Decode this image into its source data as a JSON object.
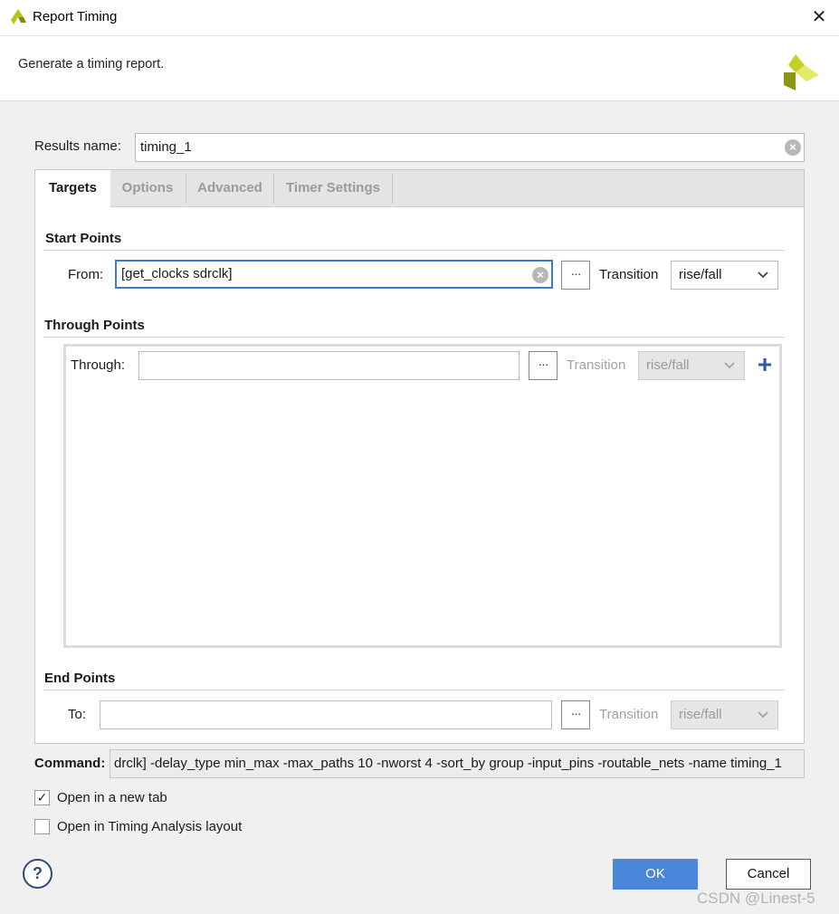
{
  "window": {
    "title": "Report Timing",
    "close_glyph": "✕"
  },
  "header": {
    "subtitle": "Generate a timing report."
  },
  "results_name": {
    "label": "Results name:",
    "value": "timing_1"
  },
  "tabs": [
    {
      "label": "Targets",
      "active": true
    },
    {
      "label": "Options",
      "active": false
    },
    {
      "label": "Advanced",
      "active": false
    },
    {
      "label": "Timer Settings",
      "active": false
    }
  ],
  "start_points": {
    "title": "Start Points",
    "from_label": "From:",
    "from_value": "[get_clocks sdrclk]",
    "browse_label": "···",
    "transition_label": "Transition",
    "transition_value": "rise/fall"
  },
  "through_points": {
    "title": "Through Points",
    "through_label": "Through:",
    "through_value": "",
    "browse_label": "···",
    "transition_label": "Transition",
    "transition_value": "rise/fall",
    "add_glyph": "+"
  },
  "end_points": {
    "title": "End Points",
    "to_label": "To:",
    "to_value": "",
    "browse_label": "···",
    "transition_label": "Transition",
    "transition_value": "rise/fall"
  },
  "command": {
    "label": "Command:",
    "value": "drclk] -delay_type min_max -max_paths 10 -nworst 4 -sort_by group -input_pins -routable_nets -name timing_1"
  },
  "options": {
    "open_new_tab": {
      "label": "Open in a new tab",
      "checked": true
    },
    "open_timing_layout": {
      "label": "Open in Timing Analysis layout",
      "checked": false
    }
  },
  "buttons": {
    "help": "?",
    "ok": "OK",
    "cancel": "Cancel"
  },
  "watermark": "CSDN @Linest-5",
  "colors": {
    "accent": "#4a86d9",
    "focus_border": "#3b7bd6",
    "add_icon": "#2c59a8",
    "logo_green": "#a3b318"
  }
}
